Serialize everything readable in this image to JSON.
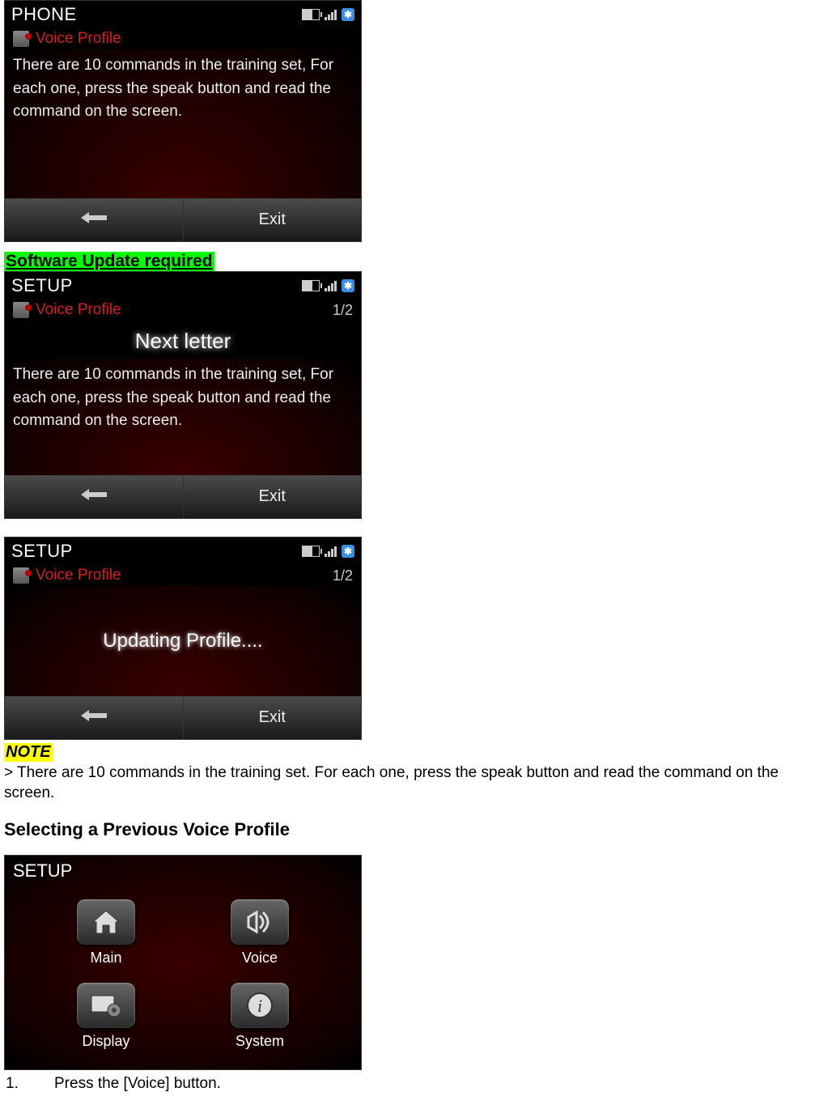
{
  "screen1": {
    "title": "PHONE",
    "profile_label": "Voice Profile",
    "body": "There are 10 commands in the training set, For each one, press the speak button and read the command on the screen.",
    "exit": "Exit"
  },
  "heading_update": "Software Update required",
  "screen2": {
    "title": "SETUP",
    "profile_label": "Voice Profile",
    "counter": "1/2",
    "big_command": "Next letter",
    "body": "There are 10 commands in the training set, For each one, press the speak button and read the command on the screen.",
    "exit": "Exit"
  },
  "screen3": {
    "title": "SETUP",
    "profile_label": "Voice Profile",
    "counter": "1/2",
    "updating": "Updating Profile....",
    "exit": "Exit"
  },
  "note_label": "NOTE",
  "note_body": "> There are 10 commands in the training set. For each one, press the speak button and read the command on the screen.",
  "section_heading": "Selecting a Previous Voice Profile",
  "setup_menu": {
    "title": "SETUP",
    "items": [
      {
        "label": "Main"
      },
      {
        "label": "Voice"
      },
      {
        "label": "Display"
      },
      {
        "label": "System"
      }
    ]
  },
  "step1_num": "1.",
  "step1_text": "Press the [Voice] button."
}
